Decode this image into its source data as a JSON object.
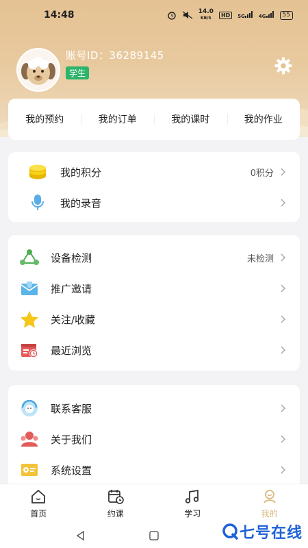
{
  "status_bar": {
    "time": "14:48",
    "speed": "14.0",
    "speed_unit": "KB/S",
    "hd": "HD",
    "net1": "5G",
    "net2": "4G",
    "battery": "55"
  },
  "profile": {
    "account_id": "账号ID：36289145",
    "role_badge": "学生"
  },
  "quick_links": [
    "我的预约",
    "我的订单",
    "我的课时",
    "我的作业"
  ],
  "card1": {
    "points_label": "我的积分",
    "points_value": "0积分",
    "recording_label": "我的录音"
  },
  "card2": {
    "device_check_label": "设备检测",
    "device_check_value": "未检测",
    "invite_label": "推广邀请",
    "favorites_label": "关注/收藏",
    "recent_label": "最近浏览"
  },
  "card3": {
    "service_label": "联系客服",
    "about_label": "关于我们",
    "settings_label": "系统设置"
  },
  "bottom_nav": {
    "home": "首页",
    "booking": "约课",
    "study": "学习",
    "mine": "我的"
  },
  "colors": {
    "header": "#e4c293",
    "badge": "#2db36a",
    "active_tab": "#d9b880",
    "watermark": "#1e62d8"
  },
  "watermark": {
    "text": "七号在线"
  }
}
